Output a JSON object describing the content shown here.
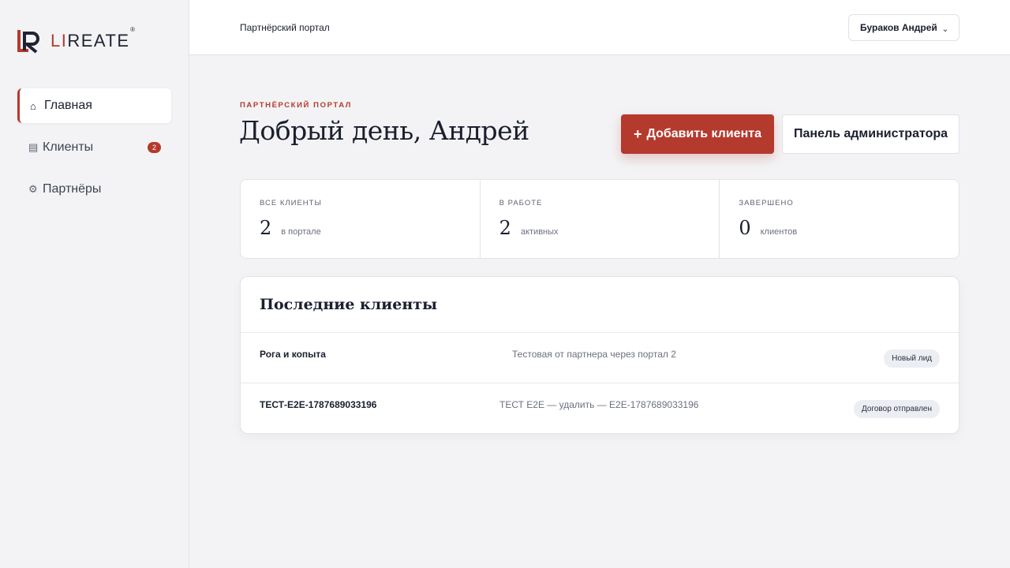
{
  "brand": {
    "logo_letter": "LR",
    "name_accent": "LI",
    "name_rest": "REATE",
    "registered": "®",
    "accent_color": "#b43a2e"
  },
  "sidebar": {
    "items": [
      {
        "icon": "⌂",
        "label": "Главная",
        "active": true
      },
      {
        "icon": "▤",
        "label": "Клиенты",
        "badge": "2"
      },
      {
        "icon": "⚙",
        "label": "Партнёры"
      }
    ]
  },
  "topbar": {
    "title": "Партнёрский портал",
    "user": "Бураков Андрей",
    "chevron": "⌄"
  },
  "header": {
    "eyebrow": "ПАРТНЁРСКИЙ ПОРТАЛ",
    "greeting": "Добрый день, Андрей",
    "add_button": "Добавить клиента",
    "add_button_icon": "+",
    "admin_button": "Панель администратора"
  },
  "stats": [
    {
      "label": "ВСЕ КЛИЕНТЫ",
      "value": "2",
      "note": "в портале"
    },
    {
      "label": "В РАБОТЕ",
      "value": "2",
      "note": "активных"
    },
    {
      "label": "ЗАВЕРШЕНО",
      "value": "0",
      "note": "клиентов"
    }
  ],
  "recent": {
    "title": "Последние клиенты",
    "rows": [
      {
        "name": "Рога и копыта",
        "description": "Тестовая от партнера через портал 2",
        "status": "Новый лид"
      },
      {
        "name": "ТЕСТ-E2E-1787689033196",
        "description": "ТЕСТ E2E — удалить — E2E-1787689033196",
        "status": "Договор отправлен"
      }
    ]
  }
}
